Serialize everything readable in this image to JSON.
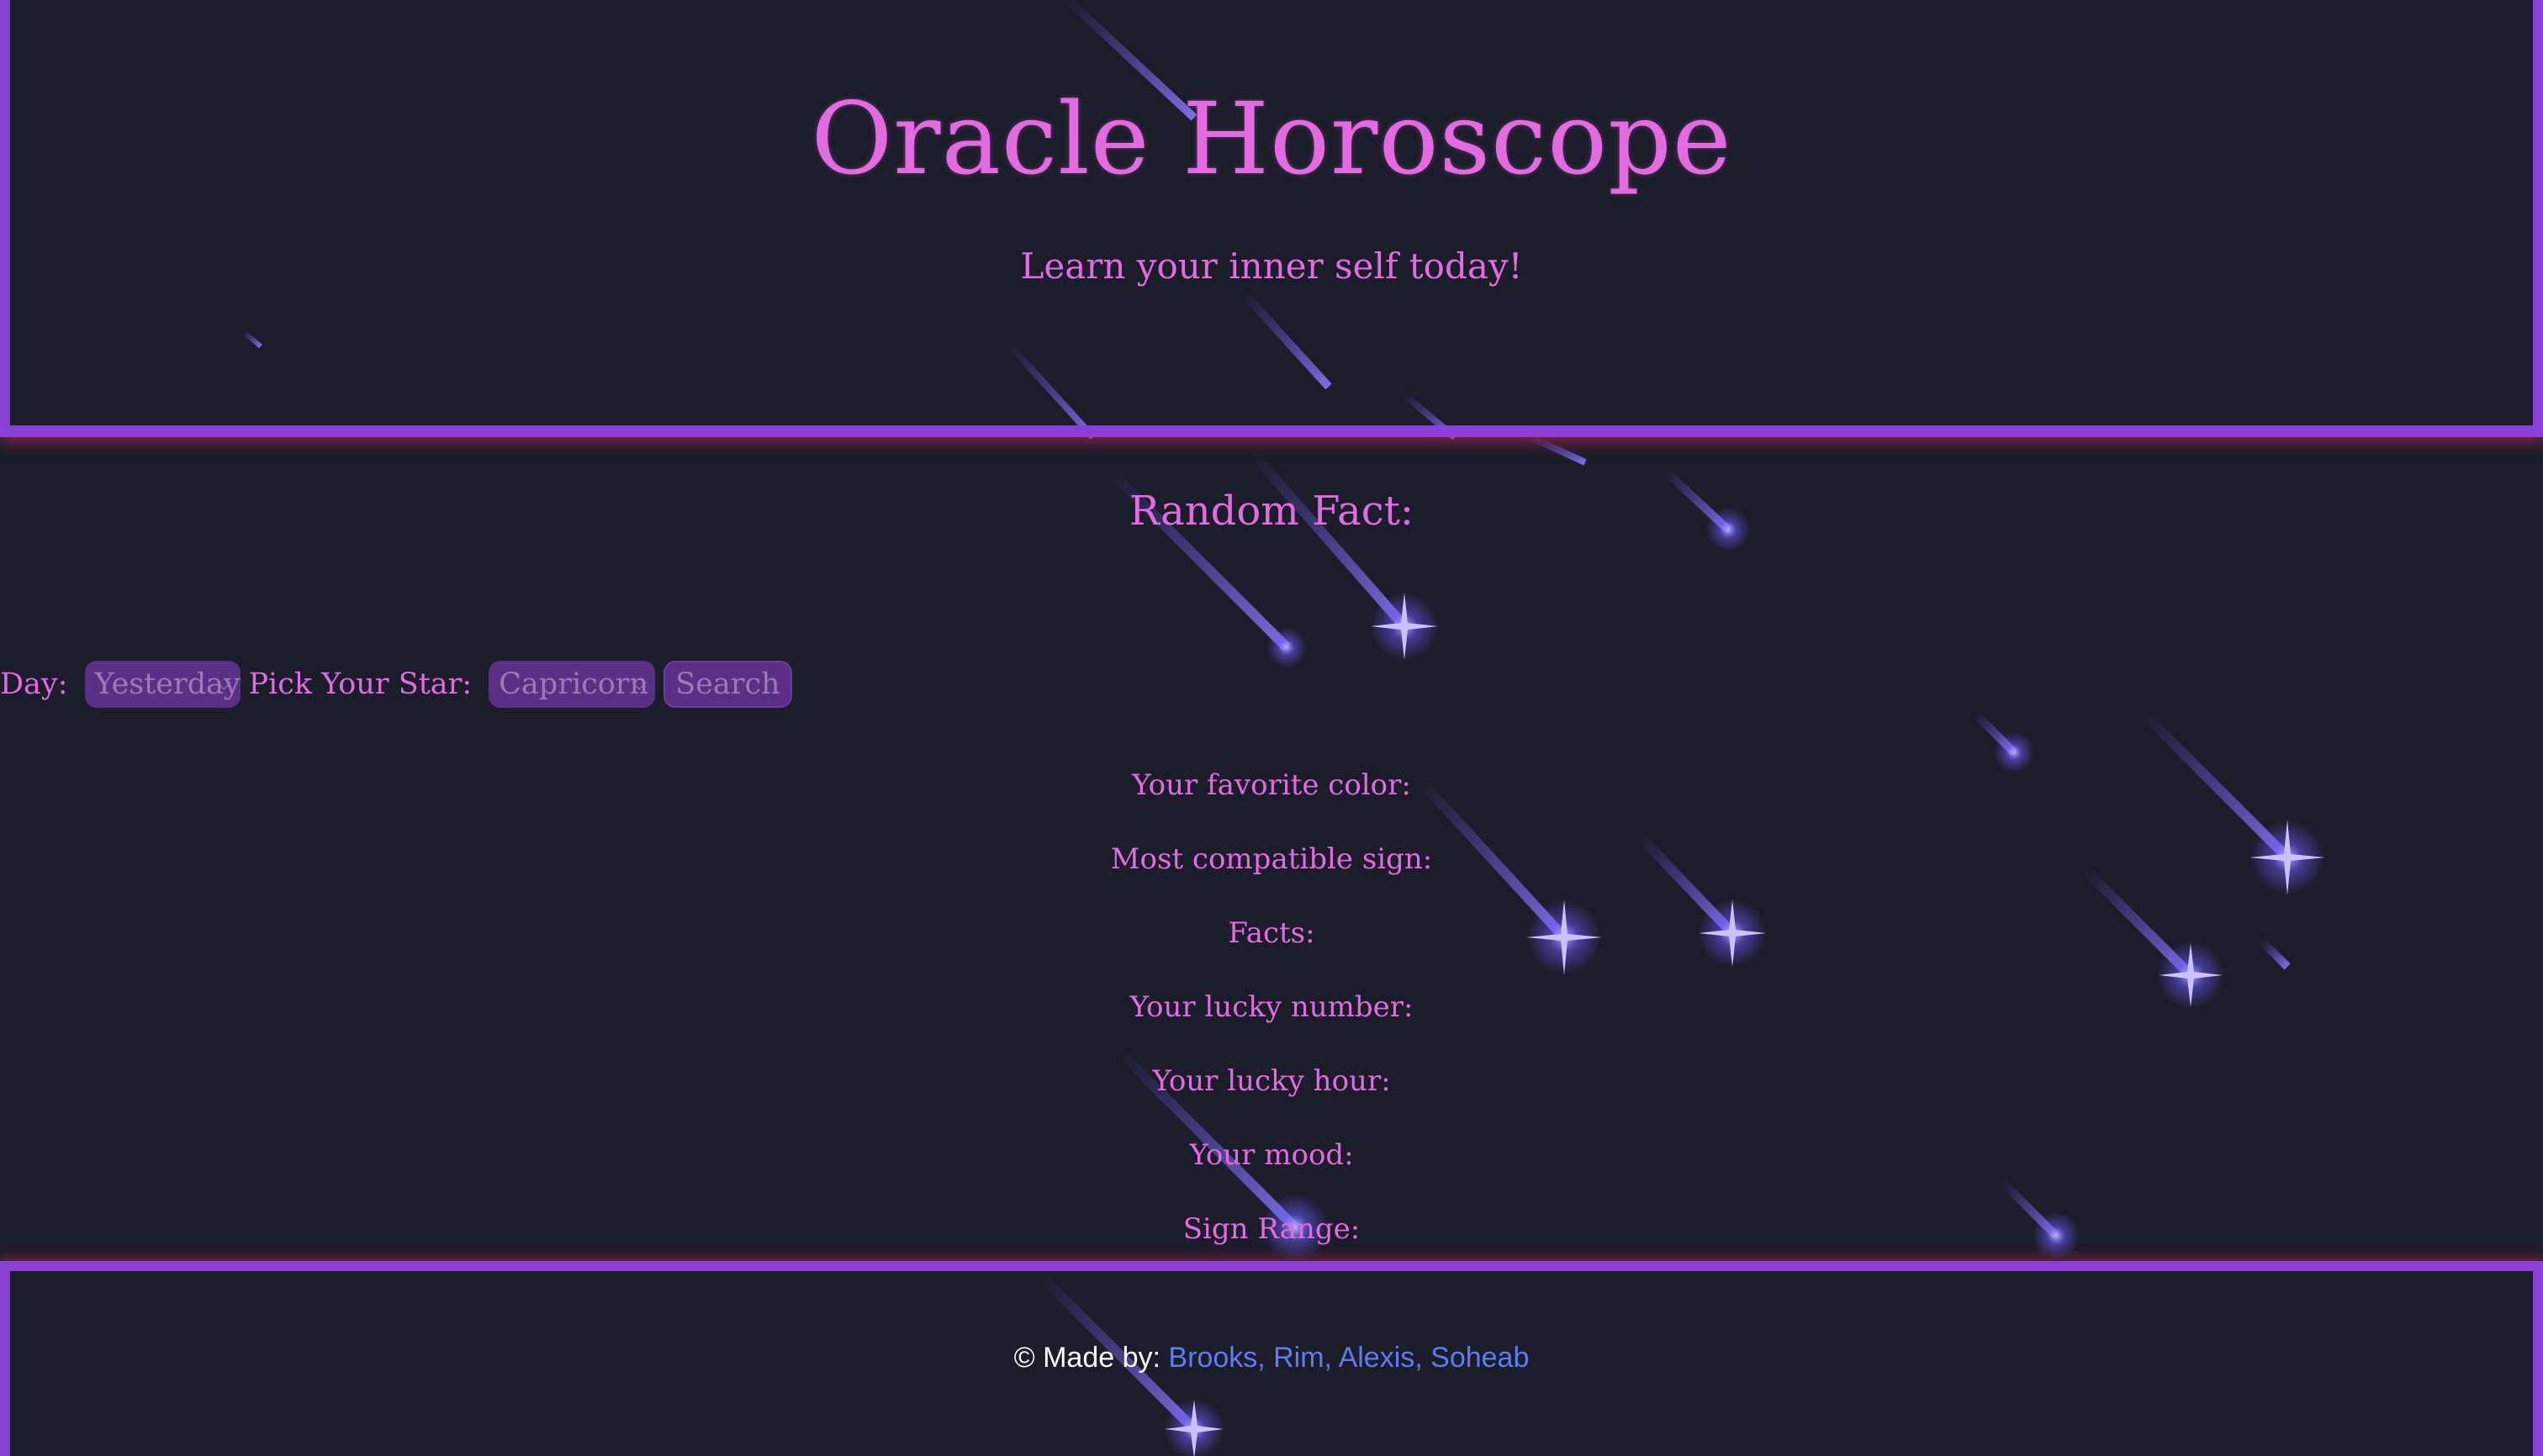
{
  "header": {
    "title": "Oracle Horoscope",
    "tagline": "Learn your inner self today!"
  },
  "main": {
    "fact_heading": "Random Fact:",
    "controls": {
      "day_label": "Day:",
      "day_value": "Yesterday",
      "star_label": "Pick Your Star:",
      "star_value": "Capricorn",
      "search_label": "Search"
    },
    "results": [
      "Your favorite color:",
      "Most compatible sign:",
      "Facts:",
      "Your lucky number:",
      "Your lucky hour:",
      "Your mood:",
      "Sign Range:"
    ]
  },
  "footer": {
    "prefix": "© Made by: ",
    "authors": "Brooks, Rim, Alexis, Soheab"
  },
  "icons": {
    "select_chevron": "chevron-down-icon",
    "background": "shooting-star-icon"
  },
  "colors": {
    "background": "#1c1d2b",
    "accent_text": "#e36ae0",
    "border": "#8a3fd6",
    "link": "#5f7bf0",
    "control_bg": "#5b2f86",
    "star": "#7b6dff"
  }
}
